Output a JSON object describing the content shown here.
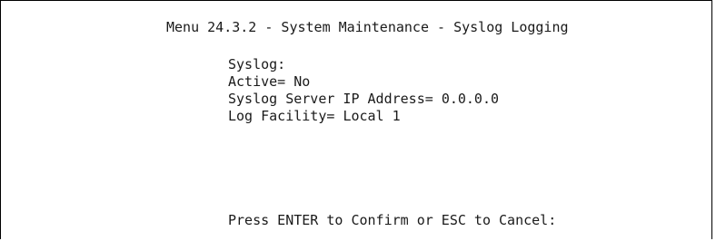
{
  "menu_title": "Menu 24.3.2 - System Maintenance - Syslog Logging",
  "fields": {
    "section_label": "Syslog:",
    "active": {
      "label": "Active=",
      "value": "No"
    },
    "server_ip": {
      "label": "Syslog Server IP Address=",
      "value": "0.0.0.0"
    },
    "log_facility": {
      "label": "Log Facility=",
      "value": "Local 1"
    }
  },
  "prompt": "Press ENTER to Confirm or ESC to Cancel:"
}
